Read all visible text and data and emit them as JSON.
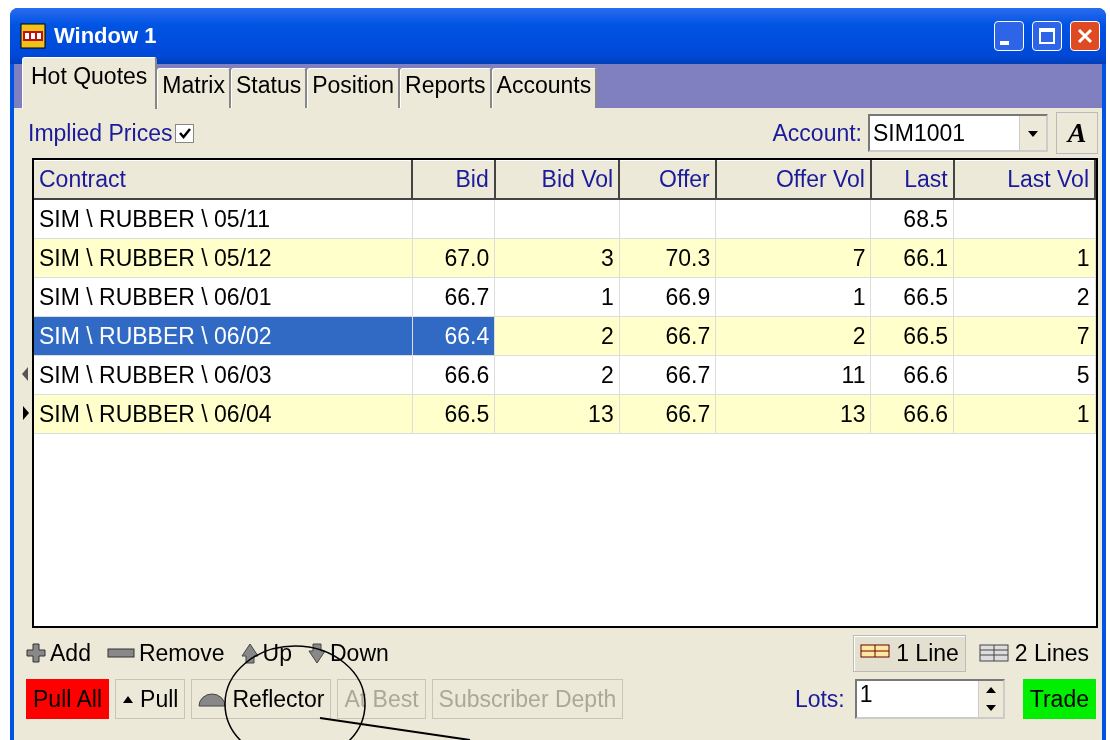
{
  "window": {
    "title": "Window 1"
  },
  "tabs": [
    {
      "label": "Hot Quotes",
      "selected": true
    },
    {
      "label": "Matrix",
      "selected": false
    },
    {
      "label": "Status",
      "selected": false
    },
    {
      "label": "Position",
      "selected": false
    },
    {
      "label": "Reports",
      "selected": false
    },
    {
      "label": "Accounts",
      "selected": false
    }
  ],
  "implied_prices": {
    "label": "Implied Prices",
    "checked": true
  },
  "account": {
    "label": "Account:",
    "value": "SIM1001"
  },
  "font_button": {
    "label": "A"
  },
  "table": {
    "columns": [
      "Contract",
      "Bid",
      "Bid Vol",
      "Offer",
      "Offer Vol",
      "Last",
      "Last Vol"
    ],
    "rows": [
      {
        "selected": false,
        "pointer_left": false,
        "pointer_right": false,
        "cells": [
          "SIM \\ RUBBER \\ 05/11",
          "",
          "",
          "",
          "",
          "68.5",
          ""
        ]
      },
      {
        "selected": false,
        "pointer_left": false,
        "pointer_right": false,
        "cells": [
          "SIM \\ RUBBER \\ 05/12",
          "67.0",
          "3",
          "70.3",
          "7",
          "66.1",
          "1"
        ]
      },
      {
        "selected": false,
        "pointer_left": false,
        "pointer_right": false,
        "cells": [
          "SIM \\ RUBBER \\ 06/01",
          "66.7",
          "1",
          "66.9",
          "1",
          "66.5",
          "2"
        ]
      },
      {
        "selected": true,
        "pointer_left": false,
        "pointer_right": false,
        "cells": [
          "SIM \\ RUBBER \\ 06/02",
          "66.4",
          "2",
          "66.7",
          "2",
          "66.5",
          "7"
        ]
      },
      {
        "selected": false,
        "pointer_left": true,
        "pointer_right": false,
        "cells": [
          "SIM \\ RUBBER \\ 06/03",
          "66.6",
          "2",
          "66.7",
          "11",
          "66.6",
          "5"
        ]
      },
      {
        "selected": false,
        "pointer_left": false,
        "pointer_right": true,
        "cells": [
          "SIM \\ RUBBER \\ 06/04",
          "66.5",
          "13",
          "66.7",
          "13",
          "66.6",
          "1"
        ]
      }
    ]
  },
  "row_tools": [
    {
      "kind": "add",
      "label": "Add"
    },
    {
      "kind": "remove",
      "label": "Remove"
    },
    {
      "kind": "up",
      "label": "Up"
    },
    {
      "kind": "down",
      "label": "Down"
    }
  ],
  "line_modes": [
    {
      "kind": "one",
      "label": "1 Line",
      "selected": true
    },
    {
      "kind": "two",
      "label": "2 Lines",
      "selected": false
    }
  ],
  "actions": [
    {
      "kind": "pull_all",
      "label": "Pull All",
      "disabled": false
    },
    {
      "kind": "pull",
      "label": "Pull",
      "disabled": false
    },
    {
      "kind": "reflector",
      "label": "Reflector",
      "disabled": false
    },
    {
      "kind": "plain",
      "label": "At Best",
      "disabled": true
    },
    {
      "kind": "plain",
      "label": "Subscriber Depth",
      "disabled": true
    }
  ],
  "lots": {
    "label": "Lots:",
    "value": "1"
  },
  "trade": {
    "label": "Trade"
  }
}
